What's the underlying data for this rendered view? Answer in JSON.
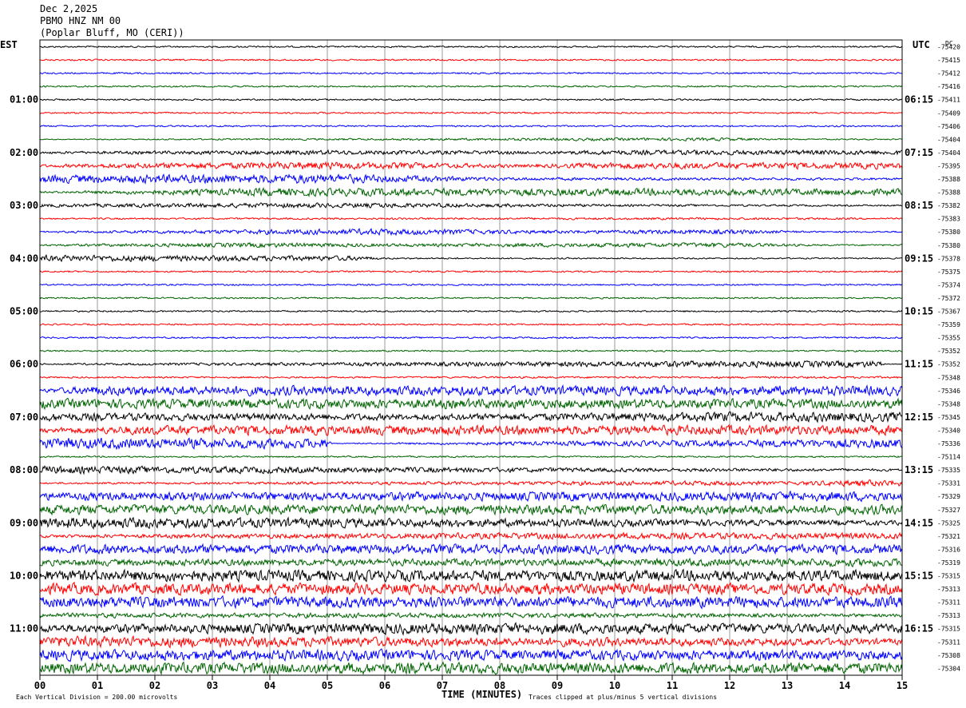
{
  "header": {
    "date": "Dec 2,2025",
    "station": "PBMO HNZ NM 00",
    "location": "(Poplar Bluff, MO (CERI))"
  },
  "axes": {
    "left_label": "EST",
    "right_label": "UTC",
    "dc_label": "DC",
    "x_title": "TIME (MINUTES)",
    "x_ticks": [
      "00",
      "01",
      "02",
      "03",
      "04",
      "05",
      "06",
      "07",
      "08",
      "09",
      "10",
      "11",
      "12",
      "13",
      "14",
      "15"
    ]
  },
  "footer": {
    "scale_note": "Each Vertical Division =  200.00 microvolts",
    "clip_note": "Traces clipped at plus/minus 5 vertical divisions"
  },
  "colors": {
    "trace_cycle": [
      "#000000",
      "#ff0000",
      "#0000ff",
      "#006400"
    ],
    "grid": "#999999"
  },
  "chart_data": {
    "type": "line",
    "title": "PBMO HNZ NM 00",
    "xlabel": "TIME (MINUTES)",
    "xlim": [
      0,
      15
    ],
    "est_hour_labels": [
      "01:00",
      "02:00",
      "03:00",
      "04:00",
      "05:00",
      "06:00",
      "07:00",
      "08:00",
      "09:00",
      "10:00",
      "11:00"
    ],
    "utc_hour_labels": [
      "06:15",
      "07:15",
      "08:15",
      "09:15",
      "10:15",
      "11:15",
      "12:15",
      "13:15",
      "14:15",
      "15:15",
      "16:15"
    ],
    "dc_offsets": [
      "-75420",
      "-75415",
      "-75412",
      "-75416",
      "-75411",
      "-75409",
      "-75406",
      "-75404",
      "-75404",
      "-75395",
      "-75388",
      "-75388",
      "-75382",
      "-75383",
      "-75380",
      "-75380",
      "-75378",
      "-75375",
      "-75374",
      "-75372",
      "-75367",
      "-75359",
      "-75355",
      "-75352",
      "-75352",
      "-75348",
      "-75346",
      "-75348",
      "-75345",
      "-75340",
      "-75336",
      "-75114",
      "-75335",
      "-75331",
      "-75329",
      "-75327",
      "-75325",
      "-75321",
      "-75316",
      "-75319",
      "-75315",
      "-75313",
      "-75311",
      "-75313",
      "-75315",
      "-75311",
      "-75308",
      "-75304"
    ],
    "trace_noise_level": [
      1,
      1,
      1,
      1,
      1,
      1,
      1,
      [
        [
          0,
          0.6
        ],
        [
          11.8,
          2
        ],
        [
          13.2,
          0.8
        ]
      ],
      [
        [
          0,
          1.5
        ],
        [
          5,
          3
        ],
        [
          8.8,
          2
        ],
        [
          10,
          3
        ],
        [
          15,
          3
        ]
      ],
      [
        [
          0,
          1.5
        ],
        [
          1,
          3
        ],
        [
          5,
          5
        ],
        [
          8.5,
          2
        ],
        [
          10,
          4
        ],
        [
          15,
          4
        ]
      ],
      [
        [
          0,
          5
        ],
        [
          5,
          6
        ],
        [
          8,
          2
        ],
        [
          15,
          1.5
        ]
      ],
      [
        [
          0,
          1
        ],
        [
          4,
          5
        ],
        [
          15,
          4
        ]
      ],
      [
        [
          0,
          2
        ],
        [
          4,
          3
        ],
        [
          6,
          3
        ],
        [
          10,
          1.5
        ],
        [
          15,
          1
        ]
      ],
      [
        [
          0,
          1
        ],
        [
          13,
          1.5
        ],
        [
          15,
          1
        ]
      ],
      [
        [
          0,
          1
        ],
        [
          4,
          3
        ],
        [
          6,
          4
        ],
        [
          9,
          2
        ],
        [
          12,
          3
        ],
        [
          13.5,
          1
        ]
      ],
      [
        [
          0,
          1
        ],
        [
          1.5,
          2
        ],
        [
          4,
          3
        ],
        [
          6,
          2
        ],
        [
          12,
          3
        ],
        [
          13.5,
          1
        ]
      ],
      [
        [
          0,
          4
        ],
        [
          5.5,
          3
        ],
        [
          6,
          1
        ],
        [
          15,
          0.8
        ]
      ],
      1,
      1,
      1,
      1,
      1,
      1,
      1,
      [
        [
          0,
          1
        ],
        [
          12,
          4
        ],
        [
          14.6,
          4
        ],
        [
          14.7,
          0.5
        ]
      ],
      [
        [
          0,
          1
        ],
        [
          15,
          1.3
        ]
      ],
      [
        [
          0,
          2
        ],
        [
          1,
          6
        ],
        [
          15,
          6
        ]
      ],
      [
        [
          0,
          6
        ],
        [
          15,
          6
        ]
      ],
      [
        [
          0,
          5
        ],
        [
          7,
          4
        ],
        [
          12,
          6
        ],
        [
          15,
          6
        ]
      ],
      [
        [
          0,
          3
        ],
        [
          2,
          6
        ],
        [
          15,
          6
        ]
      ],
      [
        [
          0,
          7
        ],
        [
          5,
          6
        ],
        [
          5.1,
          0.5
        ],
        [
          15,
          6
        ]
      ],
      1,
      [
        [
          0,
          5
        ],
        [
          4,
          4
        ],
        [
          8,
          3
        ],
        [
          15,
          1.5
        ]
      ],
      [
        [
          0,
          1
        ],
        [
          12,
          3
        ],
        [
          13,
          2
        ],
        [
          14,
          4
        ],
        [
          15,
          4
        ]
      ],
      [
        [
          0,
          5
        ],
        [
          15,
          6
        ]
      ],
      [
        [
          0,
          6
        ],
        [
          15,
          6
        ]
      ],
      [
        [
          0,
          7
        ],
        [
          9,
          5
        ],
        [
          15,
          3
        ]
      ],
      [
        [
          0,
          2
        ],
        [
          8,
          4
        ],
        [
          15,
          4
        ]
      ],
      [
        [
          0,
          6
        ],
        [
          15,
          6
        ]
      ],
      [
        [
          0,
          4
        ],
        [
          15,
          5
        ]
      ],
      [
        [
          0,
          7
        ],
        [
          15,
          7
        ]
      ],
      [
        [
          0,
          7
        ],
        [
          15,
          7
        ]
      ],
      [
        [
          0,
          7
        ],
        [
          15,
          7
        ]
      ],
      [
        [
          0,
          3
        ],
        [
          10,
          3
        ],
        [
          15,
          2
        ]
      ],
      [
        [
          0,
          5
        ],
        [
          6,
          7
        ],
        [
          15,
          6
        ]
      ],
      [
        [
          0,
          7
        ],
        [
          12,
          5
        ],
        [
          15,
          4
        ]
      ],
      [
        [
          0,
          7
        ],
        [
          15,
          6
        ]
      ],
      [
        [
          0,
          7
        ],
        [
          15,
          7
        ]
      ]
    ]
  }
}
